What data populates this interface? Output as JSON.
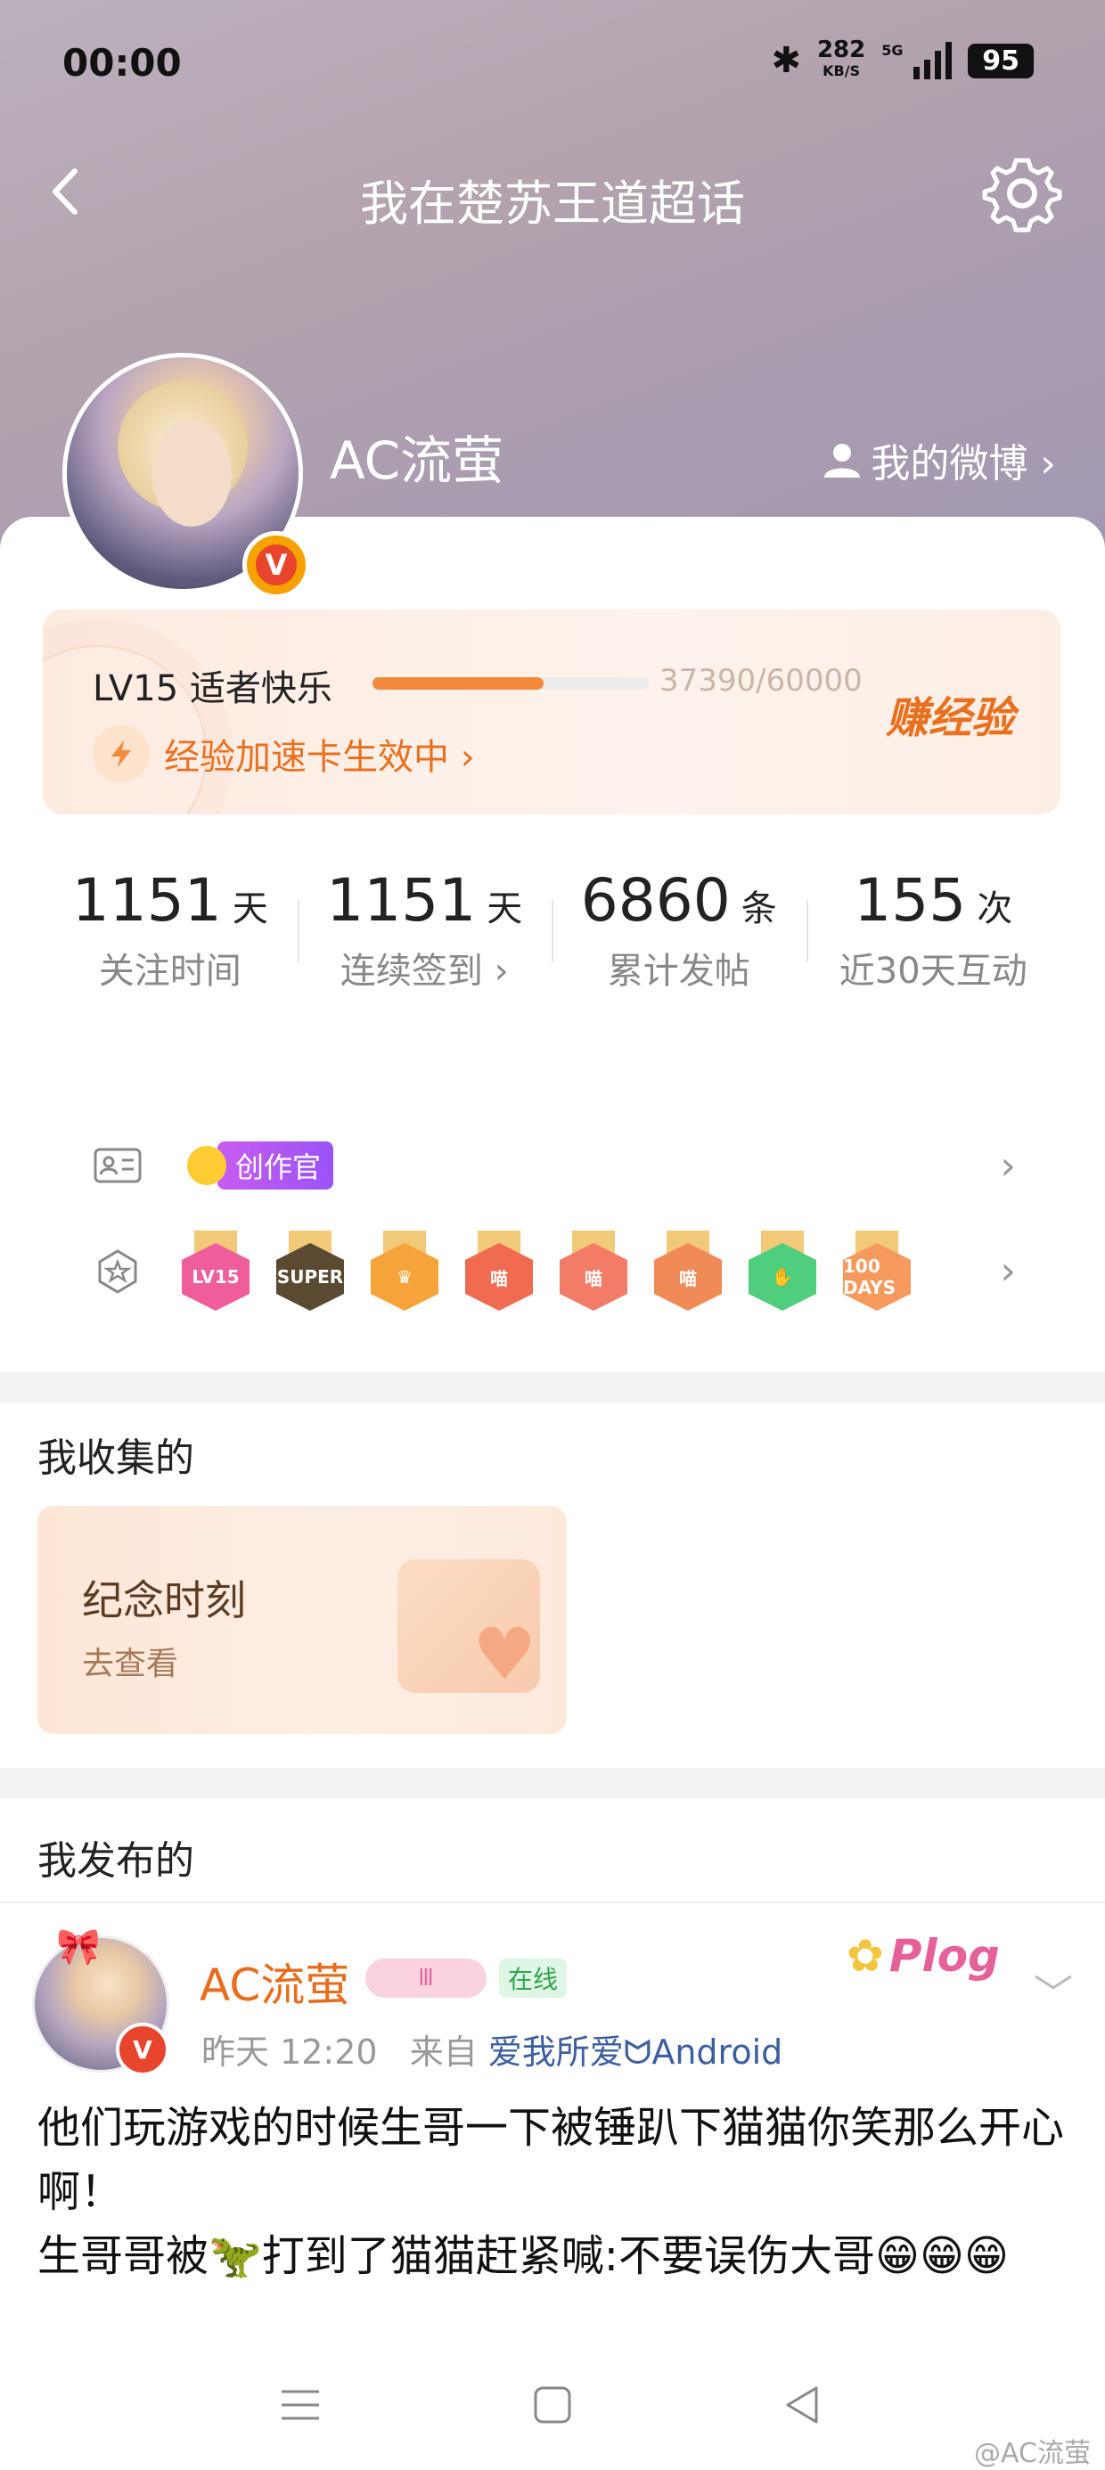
{
  "status_bar": {
    "time": "00:00",
    "speed": "282",
    "speed_unit": "KB/S",
    "net": "5G",
    "battery": "95"
  },
  "header": {
    "title": "我在楚苏王道超话"
  },
  "profile": {
    "username": "AC流萤",
    "verified": "V",
    "my_weibo": "我的微博 ›"
  },
  "level": {
    "text": "LV15 适者快乐",
    "progress": 0.62,
    "progress_text": "37390/60000",
    "boost": "经验加速卡生效中 ›",
    "earn": "赚经验"
  },
  "stats": [
    {
      "value": "1151",
      "unit": "天",
      "label": "关注时间"
    },
    {
      "value": "1151",
      "unit": "天",
      "label": "连续签到 ›"
    },
    {
      "value": "6860",
      "unit": "条",
      "label": "累计发帖"
    },
    {
      "value": "155",
      "unit": "次",
      "label": "近30天互动"
    }
  ],
  "badges": {
    "creator": "创作官",
    "chev": "›",
    "medals": [
      {
        "text": "LV15",
        "color": "#ef5d9a"
      },
      {
        "text": "SUPER",
        "color": "#5a4a32"
      },
      {
        "text": "♛",
        "color": "#f5a43a"
      },
      {
        "text": "喵",
        "color": "#f06b4f"
      },
      {
        "text": "喵",
        "color": "#f27c66"
      },
      {
        "text": "喵",
        "color": "#f08a56"
      },
      {
        "text": "✋",
        "color": "#4fcf7d"
      },
      {
        "text": "100 DAYS",
        "color": "#f59a5c"
      }
    ]
  },
  "collected": {
    "title": "我收集的",
    "card_title": "纪念时刻",
    "card_sub": "去查看"
  },
  "posted": {
    "title": "我发布的"
  },
  "post": {
    "author": "AC流萤",
    "verified": "V",
    "level_badge": "Ⅲ",
    "online": "在线",
    "plog": "Plog",
    "time": "昨天 12:20",
    "from": "来自",
    "source": "爱我所爱ᗢAndroid",
    "chev": "﹀",
    "text_line1": "他们玩游戏的时候生哥一下被锤趴下猫猫你笑那么开心啊！",
    "text_line2": "生哥哥被🦖打到了猫猫赶紧喊:不要误伤大哥😁😁😁"
  },
  "watermark": "@AC流萤"
}
